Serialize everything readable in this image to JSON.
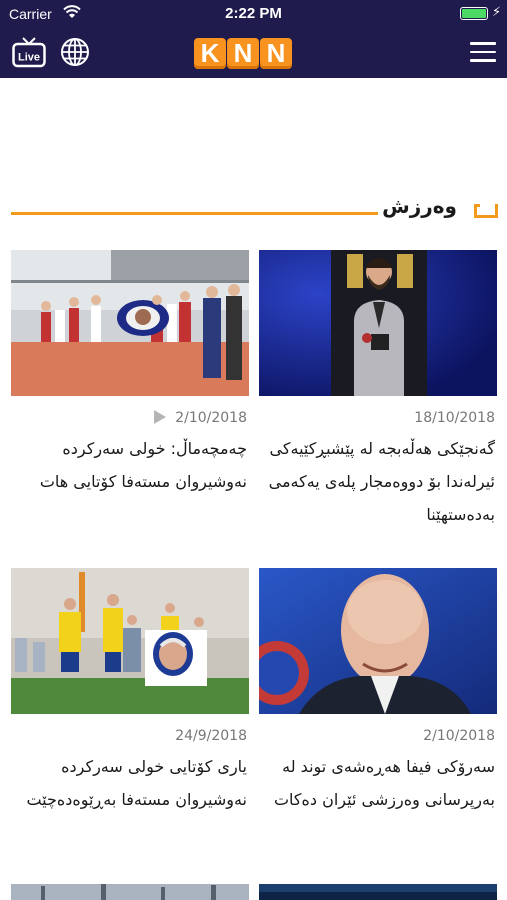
{
  "status_bar": {
    "carrier": "Carrier",
    "time": "2:22 PM",
    "battery_level": 1.0
  },
  "header": {
    "logo_letters": [
      "K",
      "N",
      "N"
    ],
    "live_label": "Live",
    "icons": [
      "live-tv-icon",
      "globe-icon",
      "hamburger-menu-icon"
    ],
    "background_color": "#1f1b4d",
    "accent_color": "#f7931e"
  },
  "section": {
    "title": "وەرزش",
    "accent_color": "#f39a1b"
  },
  "articles": [
    {
      "date": "18/10/2018",
      "title": "گەنجێکی هەڵەبجە لە پێشبڕكێیەکی ئیرلەندا بۆ دووەمجار پلەی یەکەمی بەدەستهێنا",
      "has_video": false
    },
    {
      "date": "2/10/2018",
      "title": "چەمچەماڵ: خولی سەرکردە نەوشیروان مستەفا کۆتایی هات",
      "has_video": true
    },
    {
      "date": "2/10/2018",
      "title": "سەرۆکی فیفا هەڕەشەی توند لە بەرپرسانی وەرزشی ئێران دەکات",
      "has_video": false
    },
    {
      "date": "24/9/2018",
      "title": "یاری کۆتایی خولی سەرکردە نەوشیروان مستەفا بەڕێوەدەچێت",
      "has_video": false
    }
  ]
}
